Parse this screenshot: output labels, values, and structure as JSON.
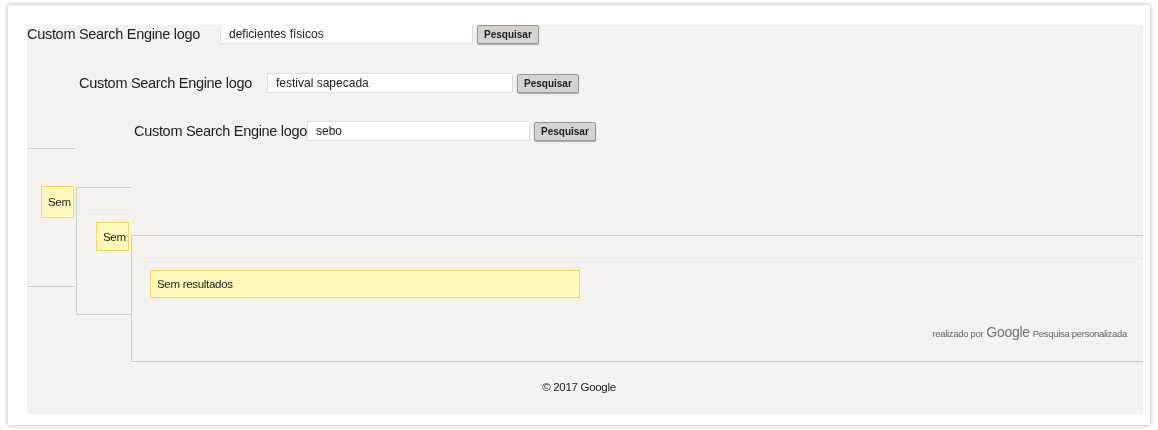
{
  "search_bars": [
    {
      "label": "Custom Search Engine logo",
      "query": "deficientes físicos",
      "button": "Pesquisar"
    },
    {
      "label": "Custom Search Engine logo",
      "query": "festival sapecada",
      "button": "Pesquisar"
    },
    {
      "label": "Custom Search Engine logo",
      "query": "sebo",
      "button": "Pesquisar"
    }
  ],
  "result_panels": [
    {
      "message": "Sem"
    },
    {
      "message": "Sem"
    },
    {
      "message": "Sem resultados",
      "branding": {
        "prefix": "realizado por",
        "logo": "Google",
        "suffix": "Pesquisa personalizada"
      }
    }
  ],
  "footer": "© 2017 Google"
}
